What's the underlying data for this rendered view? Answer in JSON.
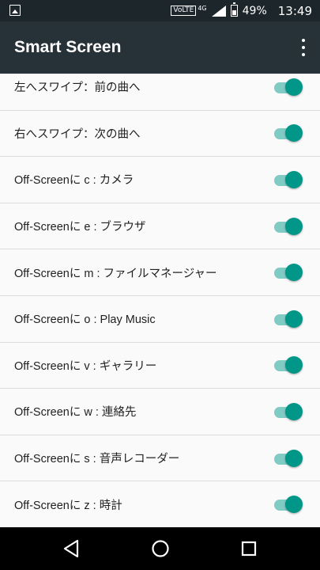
{
  "status_bar": {
    "volte": "VoLTE",
    "network": "4G",
    "battery_percent": "49%",
    "time": "13:49"
  },
  "app_bar": {
    "title": "Smart Screen"
  },
  "settings": [
    {
      "label": "左へスワイプ：前の曲へ",
      "enabled": true
    },
    {
      "label": "右へスワイプ：次の曲へ",
      "enabled": true
    },
    {
      "label": "Off-Screenに c : カメラ",
      "enabled": true
    },
    {
      "label": "Off-Screenに e : ブラウザ",
      "enabled": true
    },
    {
      "label": "Off-Screenに m : ファイルマネージャー",
      "enabled": true
    },
    {
      "label": "Off-Screenに o : Play Music",
      "enabled": true
    },
    {
      "label": "Off-Screenに v : ギャラリー",
      "enabled": true
    },
    {
      "label": "Off-Screenに w : 連絡先",
      "enabled": true
    },
    {
      "label": "Off-Screenに s : 音声レコーダー",
      "enabled": true
    },
    {
      "label": "Off-Screenに z : 時計",
      "enabled": true
    }
  ],
  "colors": {
    "status_bar": "#1d262b",
    "app_bar": "#263238",
    "switch_thumb": "#009688",
    "switch_track": "#80cbc4"
  }
}
